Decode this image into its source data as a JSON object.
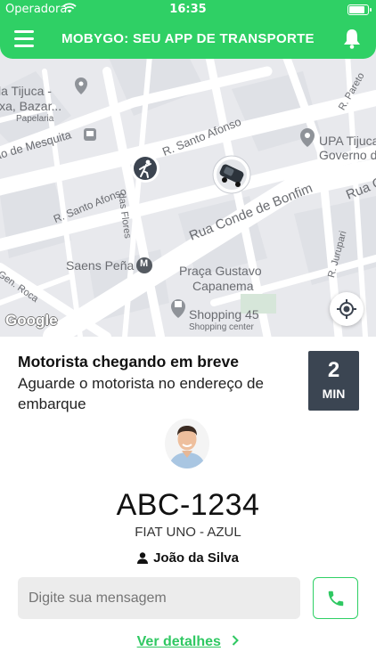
{
  "status_bar": {
    "carrier": "Operadora",
    "time": "16:35",
    "battery_level": 0.9
  },
  "header": {
    "title": "MOBYGO: SEU APP DE TRANSPORTE",
    "menu_icon": "hamburger-menu-icon",
    "bell_icon": "bell-icon"
  },
  "map": {
    "labels": {
      "tijuca": "la Tijuca -",
      "bazar": "ixa, Bazar...",
      "papelaria": "Papelaria",
      "mesquita": "ão de Mesquita",
      "santo_afonso_top": "R. Santo Afonso",
      "santo_afonso_left": "R. Santo Afonso",
      "flores": "das Flores",
      "pareto": "R. Pareto",
      "upa1": "UPA Tijuca",
      "upa2": "Governo de",
      "bonfim": "Rua Conde de Bonfim",
      "rua_co": "Rua C",
      "saens": "Saens Peña",
      "praca1": "Praça Gustavo",
      "praca2": "Capanema",
      "gen_roca": "Gen. Roca",
      "jurupari": "R. Jurupari",
      "shopping": "Shopping 45",
      "shopping_center": "Shopping center"
    },
    "attribution": "Google",
    "metro_badge": "M"
  },
  "ride": {
    "status_title": "Motorista chegando em breve",
    "status_subtitle": "Aguarde o motorista no endereço de embarque",
    "eta_value": "2",
    "eta_unit": "MIN",
    "plate": "ABC-1234",
    "car": "FIAT UNO - AZUL",
    "driver_name": "João da Silva"
  },
  "message": {
    "placeholder": "Digite sua mensagem"
  },
  "details_link": "Ver detalhes",
  "colors": {
    "brand": "#2fd065",
    "eta_bg": "#3b4552",
    "link": "#2fc862"
  }
}
